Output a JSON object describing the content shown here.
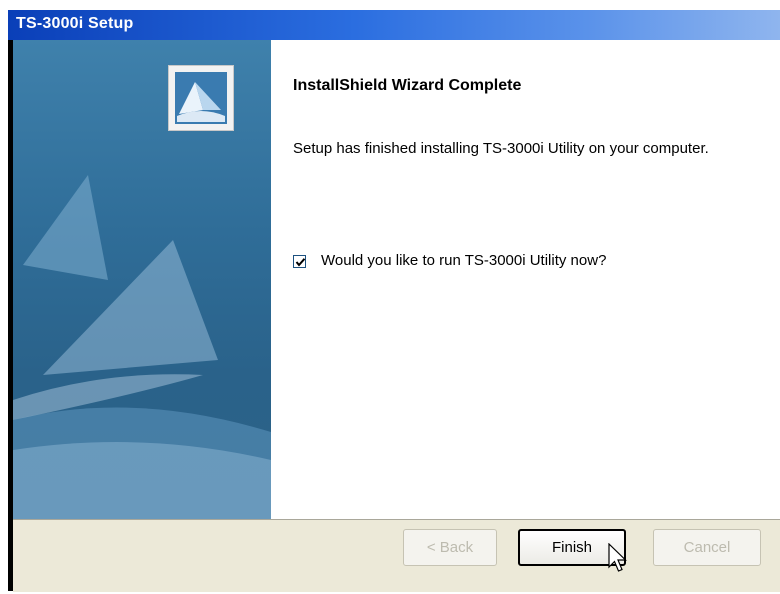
{
  "window": {
    "title": "TS-3000i Setup"
  },
  "content": {
    "heading": "InstallShield Wizard Complete",
    "message": "Setup has finished installing TS-3000i Utility on your computer.",
    "run_checkbox": {
      "label": "Would you like to run TS-3000i Utility now?",
      "checked": true
    }
  },
  "buttons": {
    "back": "< Back",
    "finish": "Finish",
    "cancel": "Cancel"
  },
  "icons": {
    "logo": "installshield-logo-icon",
    "cursor": "mouse-pointer-icon",
    "check": "checkmark-icon"
  },
  "colors": {
    "title_bar": "#2b6ee0",
    "side_panel": "#2f6d98",
    "footer": "#ece9d8"
  }
}
